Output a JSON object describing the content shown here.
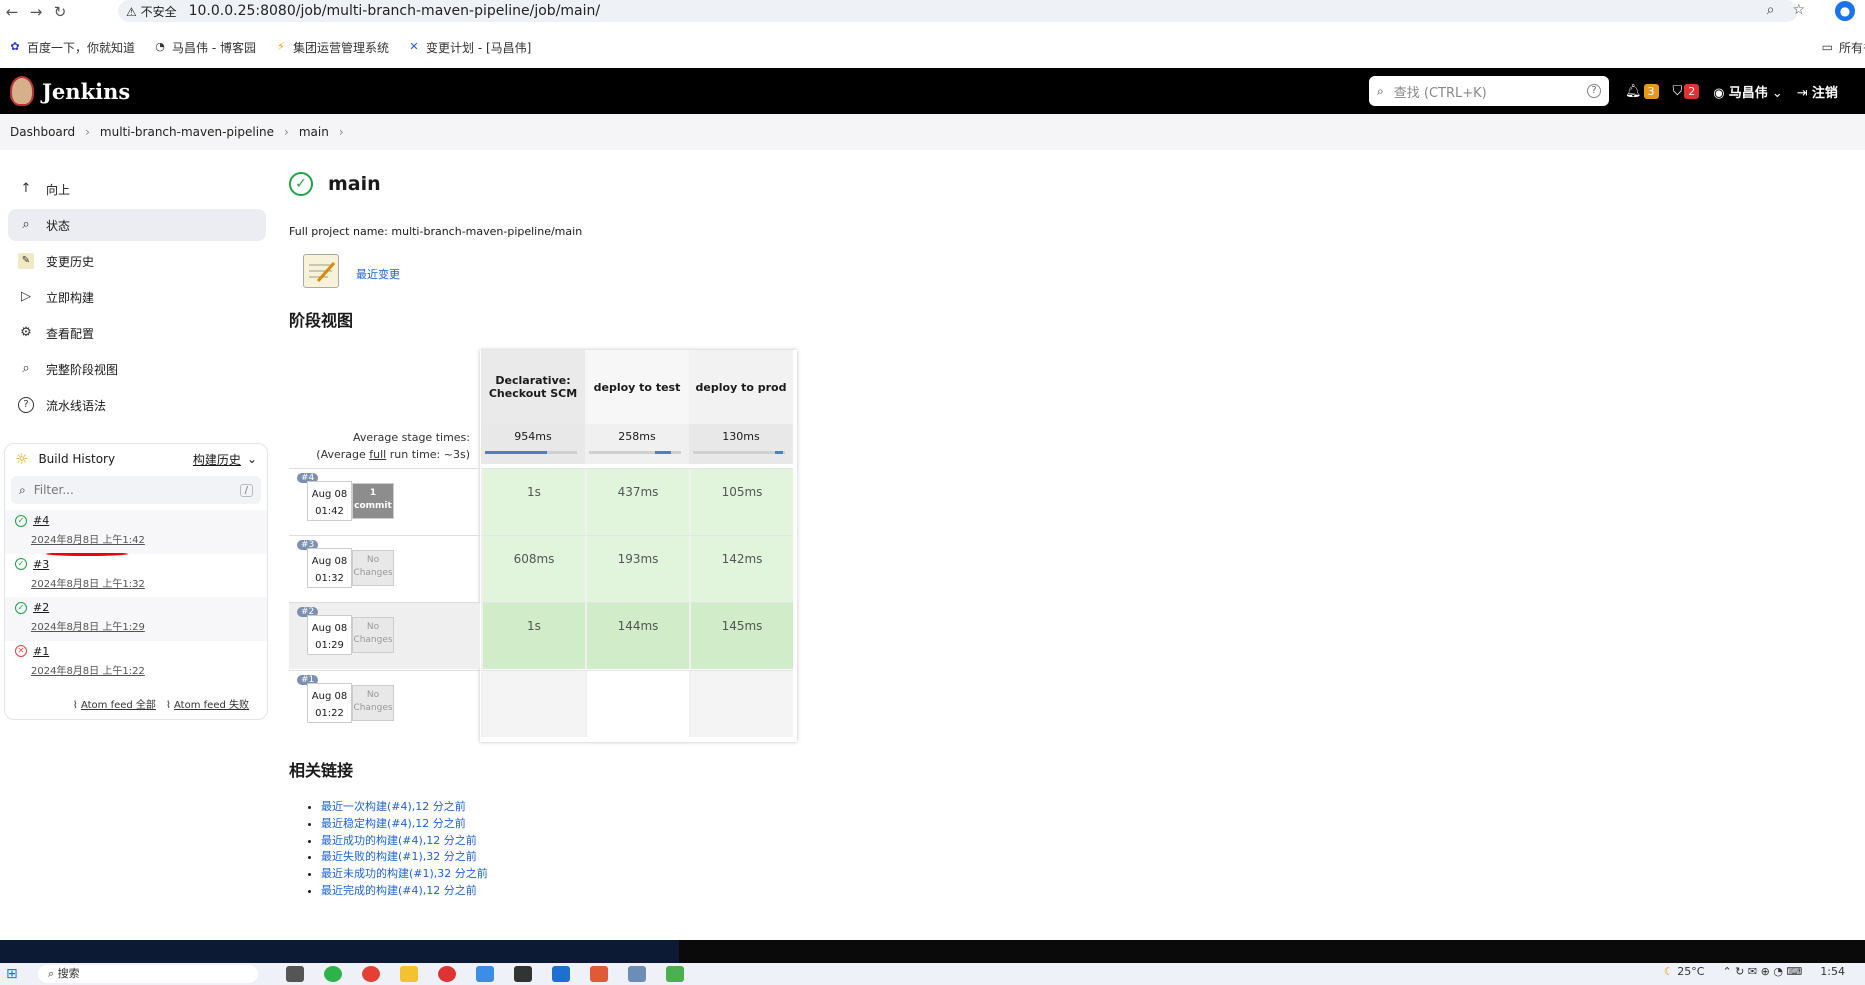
{
  "browser": {
    "insecure_label": "不安全",
    "url": "10.0.0.25:8080/job/multi-branch-maven-pipeline/job/main/",
    "bookmarks": [
      "百度一下，你就知道",
      "马昌伟 - 博客园",
      "集团运营管理系统",
      "变更计划 - [马昌伟]"
    ],
    "bookmarks_right": "所有书签"
  },
  "header": {
    "app_title": "Jenkins",
    "search_placeholder": "查找 (CTRL+K)",
    "notifications_count": "3",
    "security_count": "2",
    "user_name": "马昌伟",
    "logout_label": "注销"
  },
  "breadcrumb": [
    "Dashboard",
    "multi-branch-maven-pipeline",
    "main"
  ],
  "sidebar": {
    "items": [
      {
        "label": "向上",
        "icon": "arrow-up-icon"
      },
      {
        "label": "状态",
        "icon": "search-icon"
      },
      {
        "label": "变更历史",
        "icon": "notepad-icon"
      },
      {
        "label": "立即构建",
        "icon": "play-icon"
      },
      {
        "label": "查看配置",
        "icon": "gear-icon"
      },
      {
        "label": "完整阶段视图",
        "icon": "search-icon"
      },
      {
        "label": "流水线语法",
        "icon": "help-icon"
      }
    ]
  },
  "build_history": {
    "title": "Build History",
    "trend_label": "构建历史",
    "filter_placeholder": "Filter...",
    "filter_shortcut": "/",
    "builds": [
      {
        "num": "#4",
        "time": "2024年8月8日 上午1:42",
        "status": "success"
      },
      {
        "num": "#3",
        "time": "2024年8月8日 上午1:32",
        "status": "success"
      },
      {
        "num": "#2",
        "time": "2024年8月8日 上午1:29",
        "status": "success"
      },
      {
        "num": "#1",
        "time": "2024年8月8日 上午1:22",
        "status": "failed"
      }
    ],
    "atom_all": "Atom feed 全部",
    "atom_fail": "Atom feed 失败"
  },
  "main": {
    "title": "main",
    "full_name": "Full project name: multi-branch-maven-pipeline/main",
    "recent_changes": "最近变更",
    "stage_view_heading": "阶段视图"
  },
  "stage_view": {
    "columns": [
      "Declarative: Checkout SCM",
      "deploy to test",
      "deploy to prod"
    ],
    "avg_label_1": "Average stage times:",
    "avg_label_2_pre": "(Average ",
    "avg_label_2_link": "full",
    "avg_label_2_post": " run time: ~3s)",
    "avg_times": [
      "954ms",
      "258ms",
      "130ms"
    ],
    "rows": [
      {
        "tag": "#4",
        "date": "Aug 08",
        "time": "01:42",
        "changes": "1 commit",
        "cells": [
          "1s",
          "437ms",
          "105ms"
        ]
      },
      {
        "tag": "#3",
        "date": "Aug 08",
        "time": "01:32",
        "changes": "No Changes",
        "cells": [
          "608ms",
          "193ms",
          "142ms"
        ]
      },
      {
        "tag": "#2",
        "date": "Aug 08",
        "time": "01:29",
        "changes": "No Changes",
        "cells": [
          "1s",
          "144ms",
          "145ms"
        ]
      },
      {
        "tag": "#1",
        "date": "Aug 08",
        "time": "01:22",
        "changes": "No Changes",
        "cells": [
          "",
          "",
          ""
        ]
      }
    ]
  },
  "related": {
    "heading": "相关链接",
    "links": [
      "最近一次构建(#4),12 分之前",
      "最近稳定构建(#4),12 分之前",
      "最近成功的构建(#4),12 分之前",
      "最近失败的构建(#1),32 分之前",
      "最近未成功的构建(#1),32 分之前",
      "最近完成的构建(#4),12 分之前"
    ]
  },
  "taskbar": {
    "search": "搜索",
    "weather": "25°C",
    "clock": "1:54"
  },
  "colors": {
    "success": "#1ea446",
    "failed": "#e04444",
    "link": "#1d63d6",
    "stage_success": "#e1f5dd"
  }
}
